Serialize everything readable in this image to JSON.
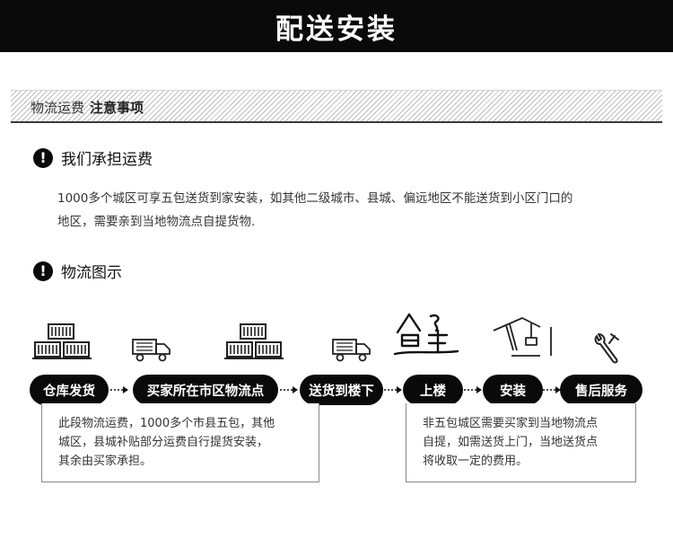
{
  "header": {
    "title": "配送安装"
  },
  "subheader": {
    "label": "物流运费",
    "strong": "注意事项"
  },
  "section1": {
    "icon": "!",
    "title": "我们承担运费",
    "lines": [
      "1000多个城区可享五包送货到家安装，如其他二级城市、县城、偏远地区不能送货到小区门口的",
      "地区，需要亲到当地物流点自提货物."
    ]
  },
  "section2": {
    "icon": "!",
    "title": "物流图示"
  },
  "flow": {
    "steps": [
      "仓库发货",
      "买家所在市区物流点",
      "送货到楼下",
      "上楼",
      "安装",
      "售后服务"
    ],
    "icons": [
      "boxes-icon",
      "truck-icon",
      "boxes-icon",
      "truck-icon",
      "stairs-icon",
      "crane-icon",
      "wrench-icon"
    ]
  },
  "notes": {
    "left": [
      "此段物流运费，1000多个市县五包，其他",
      "城区，县城补贴部分运费自行提货安装，",
      "其余由买家承担。"
    ],
    "right": [
      "非五包城区需要买家到当地物流点",
      "自提，如需送货上门，当地送货点",
      "将收取一定的费用。"
    ]
  },
  "colors": {
    "primary": "#0a0a0a",
    "text": "#333333",
    "border": "#8a8a8a"
  }
}
